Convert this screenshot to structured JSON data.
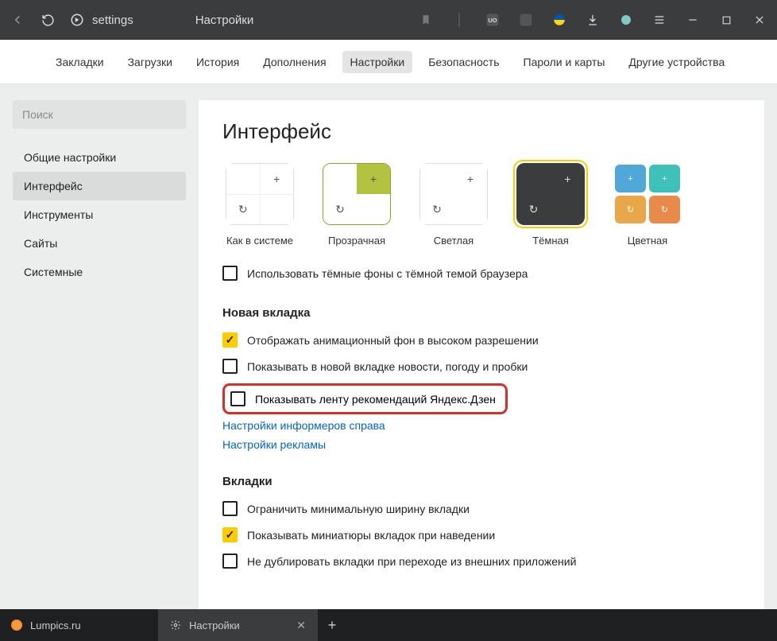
{
  "toolbar": {
    "address_scheme": "settings",
    "page_name": "Настройки"
  },
  "nav": {
    "items": [
      "Закладки",
      "Загрузки",
      "История",
      "Дополнения",
      "Настройки",
      "Безопасность",
      "Пароли и карты",
      "Другие устройства"
    ],
    "active_index": 4
  },
  "sidebar": {
    "search_placeholder": "Поиск",
    "items": [
      "Общие настройки",
      "Интерфейс",
      "Инструменты",
      "Сайты",
      "Системные"
    ],
    "active_index": 1
  },
  "main": {
    "heading": "Интерфейс",
    "themes": [
      {
        "label": "Как в системе"
      },
      {
        "label": "Прозрачная"
      },
      {
        "label": "Светлая"
      },
      {
        "label": "Тёмная",
        "selected": true
      },
      {
        "label": "Цветная"
      }
    ],
    "use_dark_bg": {
      "checked": false,
      "label": "Использовать тёмные фоны с тёмной темой браузера"
    },
    "section_newtab": {
      "title": "Новая вкладка",
      "items": [
        {
          "checked": true,
          "label": "Отображать анимационный фон в высоком разрешении"
        },
        {
          "checked": false,
          "label": "Показывать в новой вкладке новости, погоду и пробки"
        }
      ],
      "highlighted": {
        "checked": false,
        "label": "Показывать ленту рекомендаций Яндекс.Дзен"
      },
      "links": [
        "Настройки информеров справа",
        "Настройки рекламы"
      ]
    },
    "section_tabs": {
      "title": "Вкладки",
      "items": [
        {
          "checked": false,
          "label": "Ограничить минимальную ширину вкладки"
        },
        {
          "checked": true,
          "label": "Показывать миниатюры вкладок при наведении"
        },
        {
          "checked": false,
          "label": "Не дублировать вкладки при переходе из внешних приложений"
        }
      ]
    }
  },
  "tabs_bar": {
    "items": [
      {
        "label": "Lumpics.ru",
        "icon": "orange"
      },
      {
        "label": "Настройки",
        "icon": "gear",
        "active": true
      }
    ]
  },
  "colors": {
    "highlight_red": "#d93025",
    "accent_yellow": "#ffcc00"
  }
}
